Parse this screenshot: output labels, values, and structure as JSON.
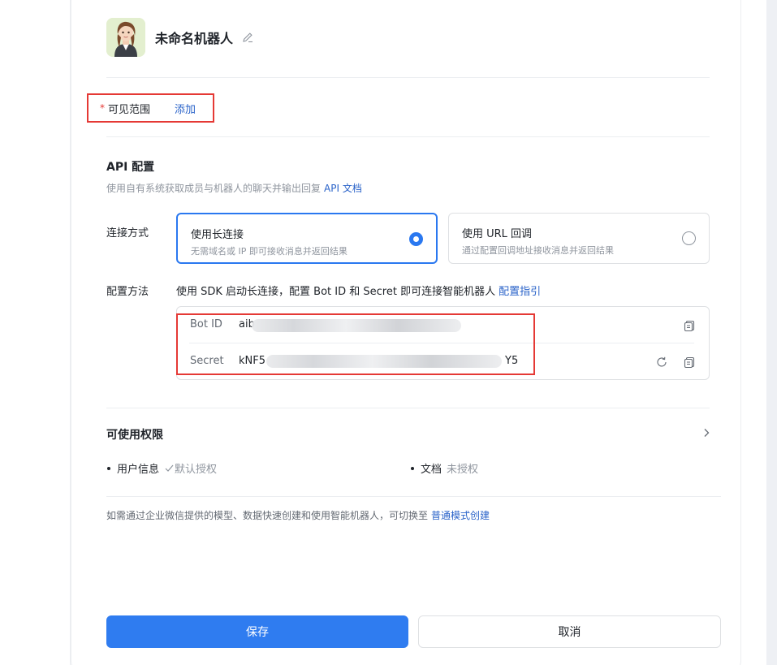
{
  "bot": {
    "name": "未命名机器人"
  },
  "scope": {
    "required_mark": "*",
    "label": "可见范围",
    "add_link": "添加"
  },
  "api": {
    "title": "API 配置",
    "description": "使用自有系统获取成员与机器人的聊天并输出回复",
    "doc_link": "API 文档"
  },
  "connection": {
    "label": "连接方式",
    "options": [
      {
        "title": "使用长连接",
        "subtitle": "无需域名或 IP 即可接收消息并返回结果",
        "selected": true
      },
      {
        "title": "使用 URL 回调",
        "subtitle": "通过配置回调地址接收消息并返回结果",
        "selected": false
      }
    ]
  },
  "config": {
    "label": "配置方法",
    "text": "使用 SDK 启动长连接，配置 Bot ID 和 Secret 即可连接智能机器人",
    "guide_link": "配置指引"
  },
  "credentials": {
    "bot_id_label": "Bot ID",
    "bot_id_prefix": "aib",
    "secret_label": "Secret",
    "secret_prefix": "kNF5",
    "secret_suffix": "Y5"
  },
  "permissions": {
    "title": "可使用权限",
    "items": [
      {
        "name": "用户信息",
        "status": "默认授权"
      },
      {
        "name": "文档",
        "status": "未授权"
      }
    ]
  },
  "footnote": {
    "text": "如需通过企业微信提供的模型、数据快速创建和使用智能机器人，可切换至",
    "link": "普通模式创建"
  },
  "actions": {
    "save": "保存",
    "cancel": "取消"
  },
  "colors": {
    "primary": "#2f7cf0",
    "link": "#2a63c9",
    "highlight_border": "#e53935"
  }
}
